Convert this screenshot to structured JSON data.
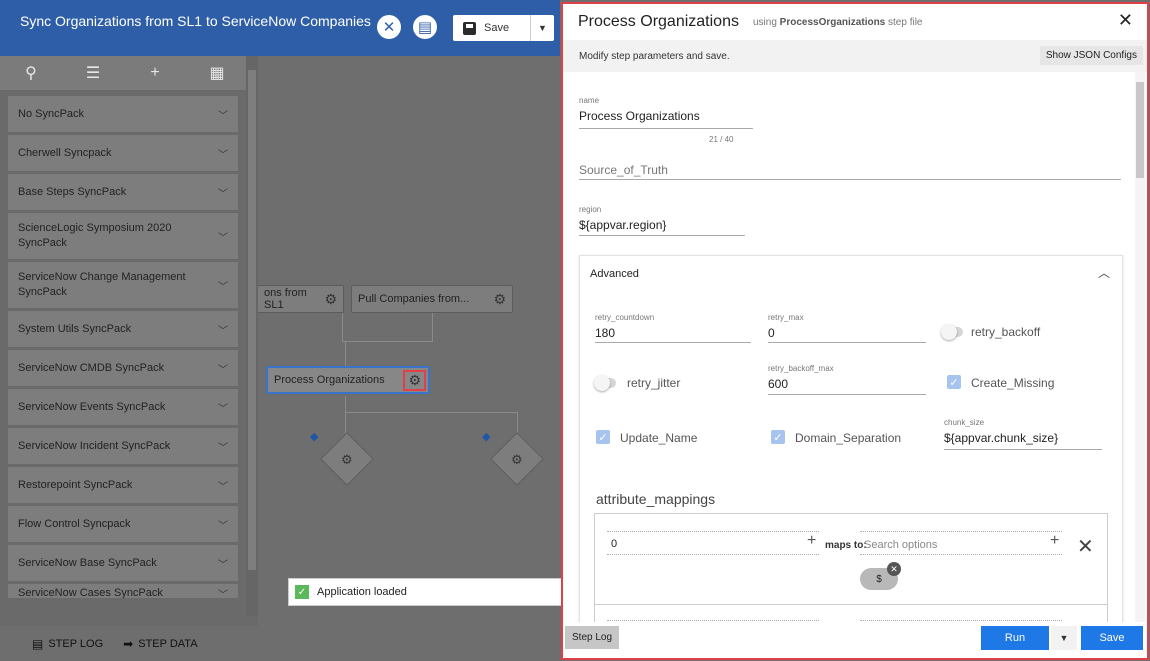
{
  "app": {
    "title": "Sync Organizations from SL1 to ServiceNow Companies",
    "save_label": "Save"
  },
  "sidebar": {
    "packs": [
      "No SyncPack",
      "Cherwell Syncpack",
      "Base Steps SyncPack",
      "ScienceLogic Symposium 2020 SyncPack",
      "ServiceNow Change Management SyncPack",
      "System Utils SyncPack",
      "ServiceNow CMDB SyncPack",
      "ServiceNow Events SyncPack",
      "ServiceNow Incident SyncPack",
      "Restorepoint SyncPack",
      "Flow Control Syncpack",
      "ServiceNow Base SyncPack",
      "ServiceNow Cases SyncPack"
    ]
  },
  "canvas": {
    "node_left": "ons from SL1",
    "node_right": "Pull Companies from...",
    "node_process": "Process Organizations"
  },
  "toast": {
    "text": "Application loaded"
  },
  "bottombar": {
    "step_log": "STEP LOG",
    "step_data": "STEP DATA"
  },
  "panel": {
    "title": "Process Organizations",
    "using_prefix": "using",
    "using_file": "ProcessOrganizations",
    "using_suffix": "step file",
    "subtitle": "Modify step parameters and save.",
    "json_button": "Show JSON Configs",
    "name_label": "name",
    "name_value": "Process Organizations",
    "name_counter": "21 / 40",
    "source_placeholder": "Source_of_Truth",
    "region_label": "region",
    "region_value": "${appvar.region}",
    "advanced_title": "Advanced",
    "retry_countdown_label": "retry_countdown",
    "retry_countdown_value": "180",
    "retry_max_label": "retry_max",
    "retry_max_value": "0",
    "retry_backoff_label": "retry_backoff",
    "retry_jitter_label": "retry_jitter",
    "retry_backoff_max_label": "retry_backoff_max",
    "retry_backoff_max_value": "600",
    "create_missing_label": "Create_Missing",
    "update_name_label": "Update_Name",
    "domain_separation_label": "Domain_Separation",
    "chunk_size_label": "chunk_size",
    "chunk_size_value": "${appvar.chunk_size}",
    "attribute_mappings_title": "attribute_mappings",
    "mapping_source": "0",
    "maps_to_label": "maps to:",
    "search_placeholder": "Search options",
    "chip_value": "$",
    "step_log_button": "Step Log",
    "run_button": "Run",
    "save_button": "Save"
  },
  "colors": {
    "accent": "#2f5ea8",
    "primary_button": "#1e78e6",
    "highlight_border": "#e0404a"
  }
}
